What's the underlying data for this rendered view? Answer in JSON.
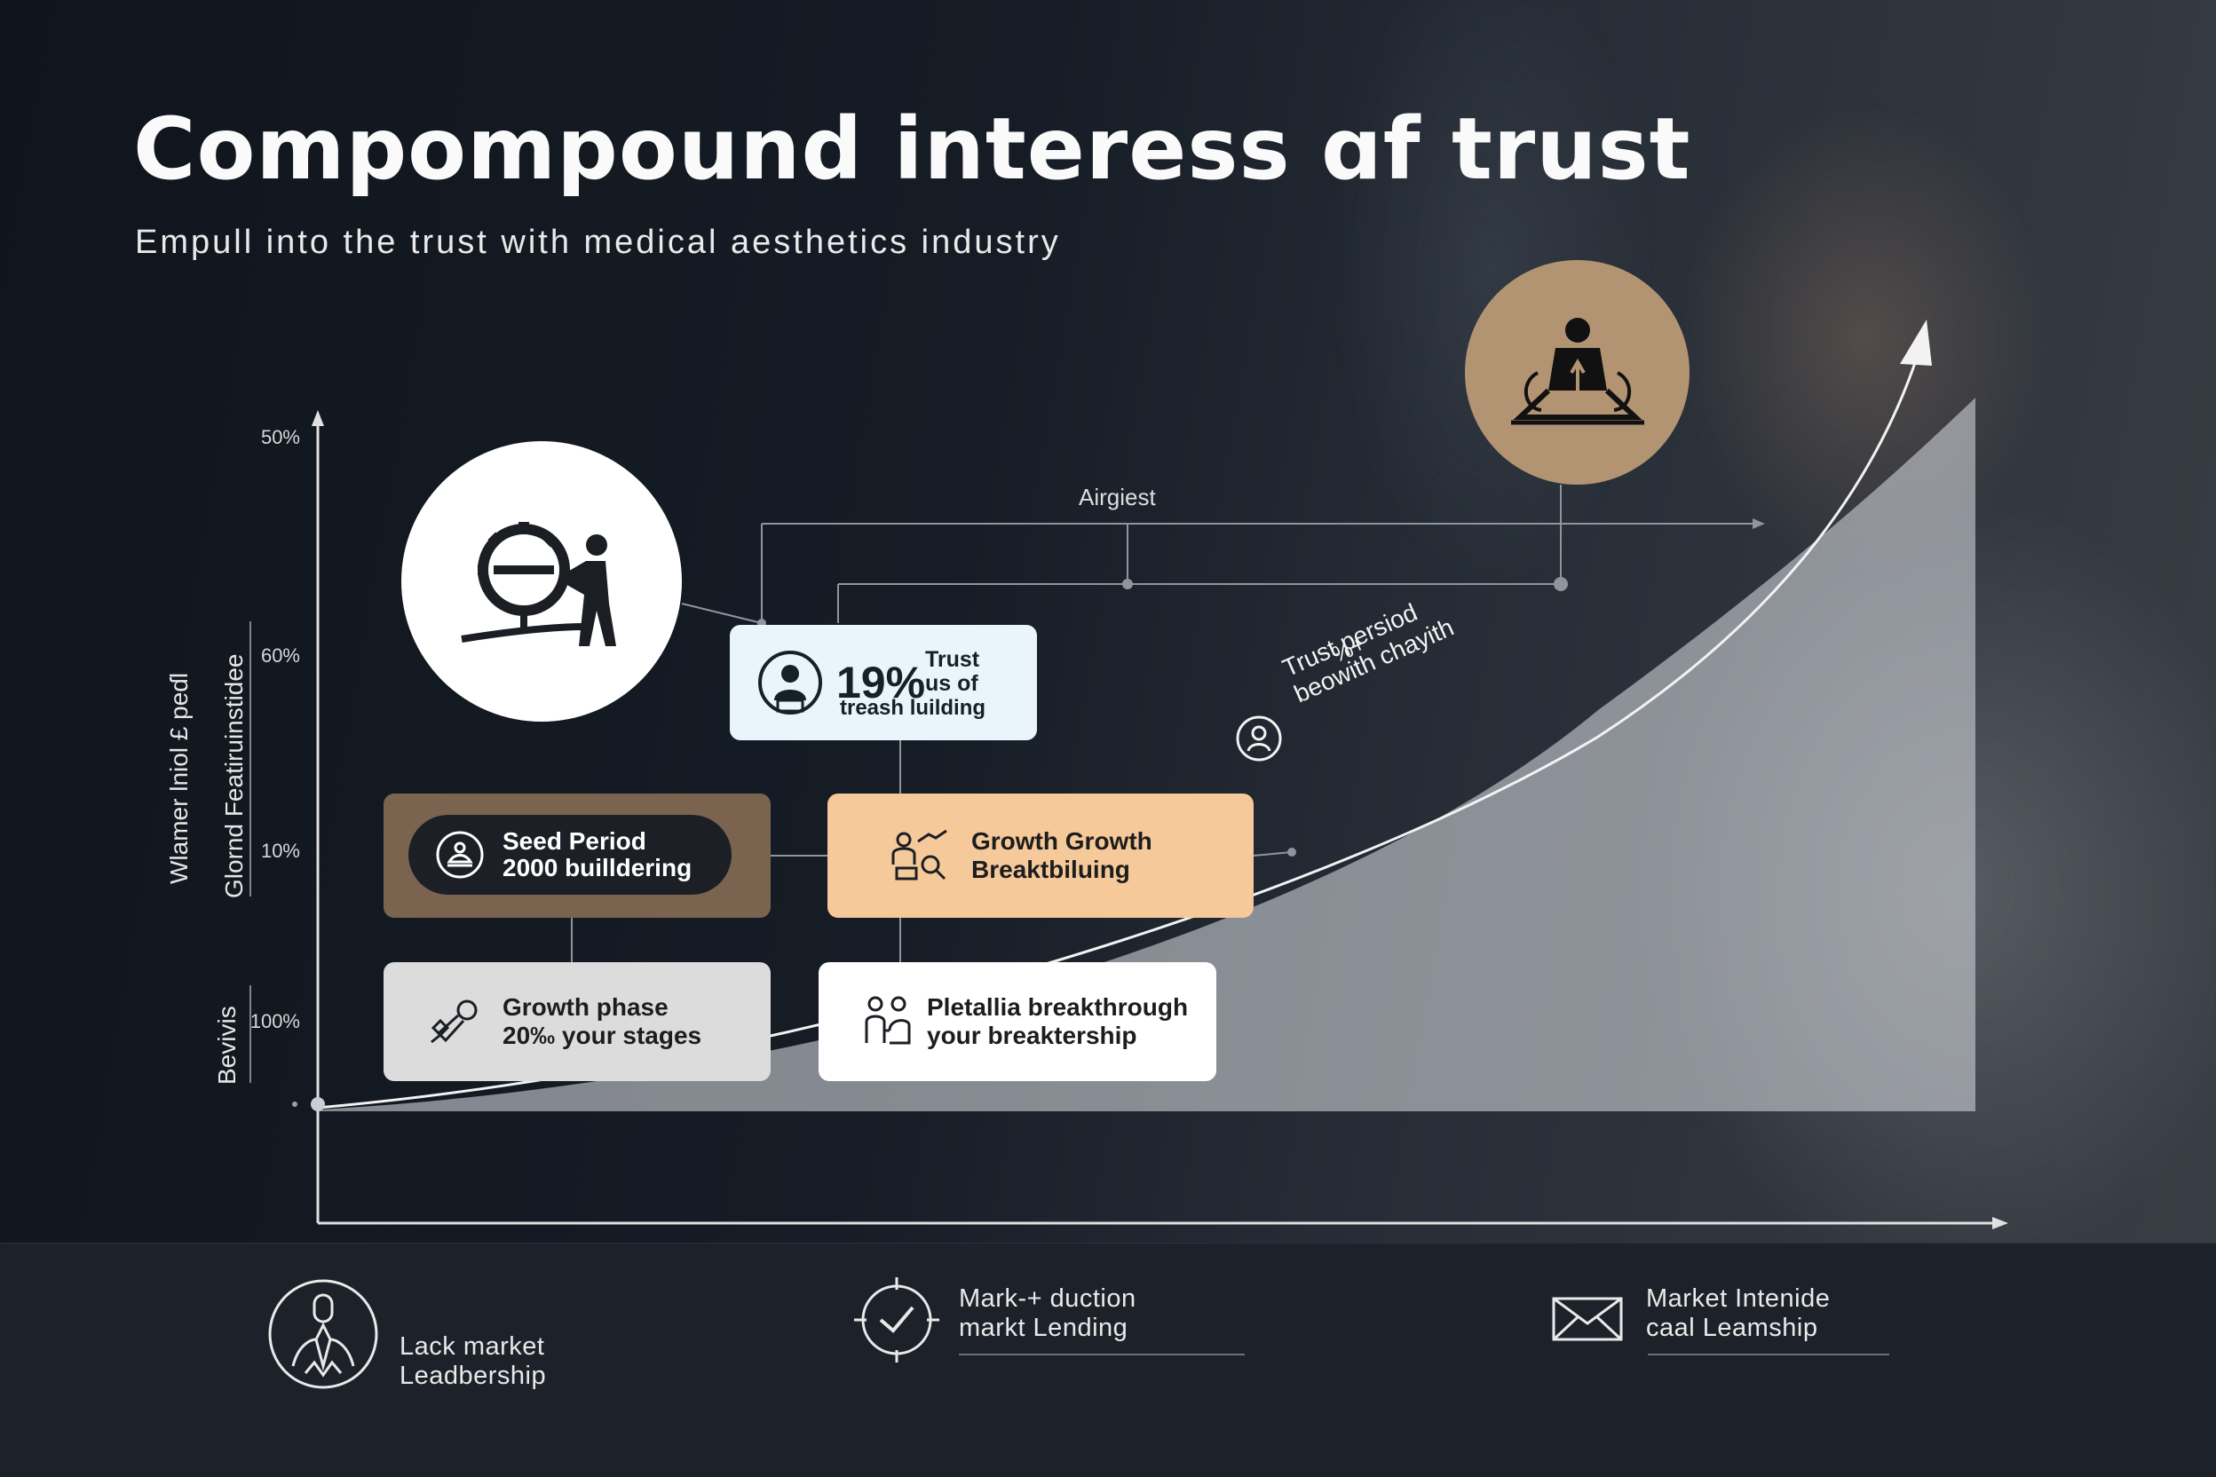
{
  "header": {
    "title": "Compompound interess ɑf trust",
    "subtitle": "Empull into the trust with  medical  aesthetics industry"
  },
  "chart": {
    "y_ticks": [
      "50%",
      "60%",
      "10%",
      "100%"
    ],
    "y_labels": [
      "Wlamer lniol £ peɗƖ",
      "Glornd  Featiruinstidee",
      "Bevivis"
    ],
    "top_note": "Airgiest",
    "curve_label_pct": "%+",
    "curve_label_lines": [
      "Trust   persiod",
      "beowith chayith"
    ]
  },
  "cards": {
    "trust": {
      "big": "19%",
      "line1": "Trust",
      "line2": "us of",
      "line3": "treash luilding"
    },
    "seed": {
      "line1": "Seed Period",
      "line2": "2000 builldering"
    },
    "growth": {
      "line1": "Growth Growth",
      "line2": "Breaktbiluing"
    },
    "phase": {
      "line1": "Growth phase",
      "line2": "20‰ your stages"
    },
    "pletallia": {
      "line1": "Pletallia breakthrough",
      "line2": "your breaktership"
    }
  },
  "footer": {
    "items": [
      {
        "icon": "leader-icon",
        "line1": "Lack market",
        "line2": "Leadbership"
      },
      {
        "icon": "target-check-icon",
        "line1": "Mark-+ duction",
        "line2": "markt Lending"
      },
      {
        "icon": "envelope-icon",
        "line1": "Market Intenide",
        "line2": "caal Leamship"
      }
    ]
  },
  "colors": {
    "background": "#161c25",
    "seed_card": "#7a6450",
    "growth_card": "#f6c99a",
    "trust_card": "#e9f5fa",
    "tan_circle": "#b39472"
  }
}
